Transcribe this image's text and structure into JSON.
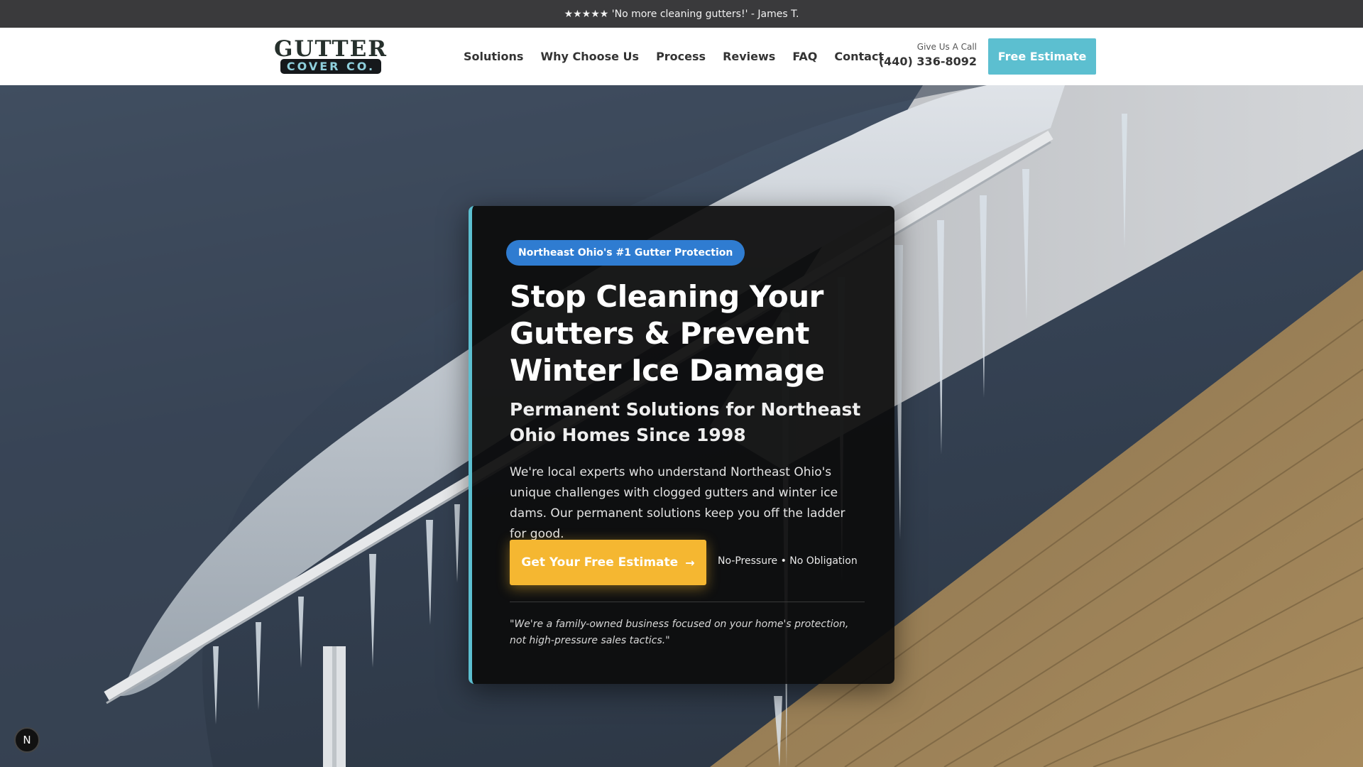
{
  "topbar": {
    "text": "★★★★★ 'No more cleaning gutters!' - James T."
  },
  "header": {
    "logo_line1": "GUTTER",
    "logo_line2": "COVER CO.",
    "nav": [
      {
        "label": "Solutions"
      },
      {
        "label": "Why Choose Us"
      },
      {
        "label": "Process"
      },
      {
        "label": "Reviews"
      },
      {
        "label": "FAQ"
      },
      {
        "label": "Contact"
      }
    ],
    "call_label": "Give Us A Call",
    "phone": "(440) 336-8092",
    "estimate_button": "Free Estimate"
  },
  "hero": {
    "badge": "Northeast Ohio's #1 Gutter Protection",
    "headline": "Stop Cleaning Your Gutters & Prevent Winter Ice Damage",
    "subheadline": "Permanent Solutions for Northeast Ohio Homes Since 1998",
    "body": "We're local experts who understand Northeast Ohio's unique challenges with clogged gutters and winter ice dams. Our permanent solutions keep you off the ladder for good.",
    "cta_label": "Get Your Free Estimate",
    "cta_arrow": "→",
    "cta_note": "No-Pressure • No Obligation",
    "quote": "\"We're a family-owned business focused on your home's protection, not high-pressure sales tactics.\""
  },
  "corner_badge": "N",
  "colors": {
    "accent": "#5cbfd0",
    "cta": "#f5b731",
    "badge": "#2f7cd1",
    "topbar": "#3a3a3c"
  }
}
